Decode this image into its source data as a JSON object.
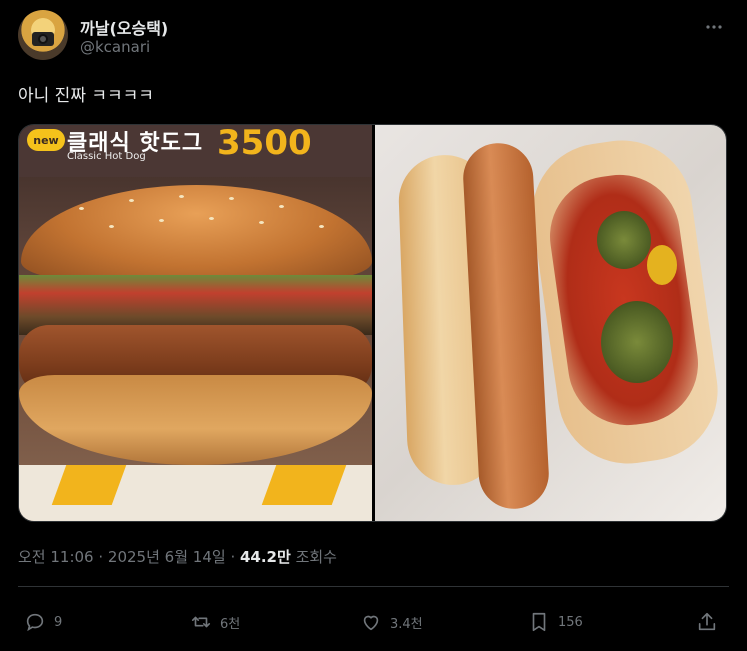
{
  "author": {
    "display_name": "까날(오승택)",
    "handle": "@kcanari"
  },
  "tweet": {
    "text": "아니 진짜 ㅋㅋㅋㅋ"
  },
  "media": {
    "poster": {
      "badge": "new",
      "title": "클래식 핫도그",
      "subtitle": "Classic Hot Dog",
      "price": "3500"
    }
  },
  "meta": {
    "time": "오전 11:06",
    "separator": " · ",
    "date": "2025년 6월 14일",
    "views_count": "44.2만",
    "views_label": "조회수"
  },
  "actions": {
    "replies": "9",
    "retweets": "6천",
    "likes": "3.4천",
    "bookmarks": "156"
  },
  "colors": {
    "background": "#000000",
    "text": "#e7e9ea",
    "muted": "#71767b",
    "border": "#2f3336"
  }
}
